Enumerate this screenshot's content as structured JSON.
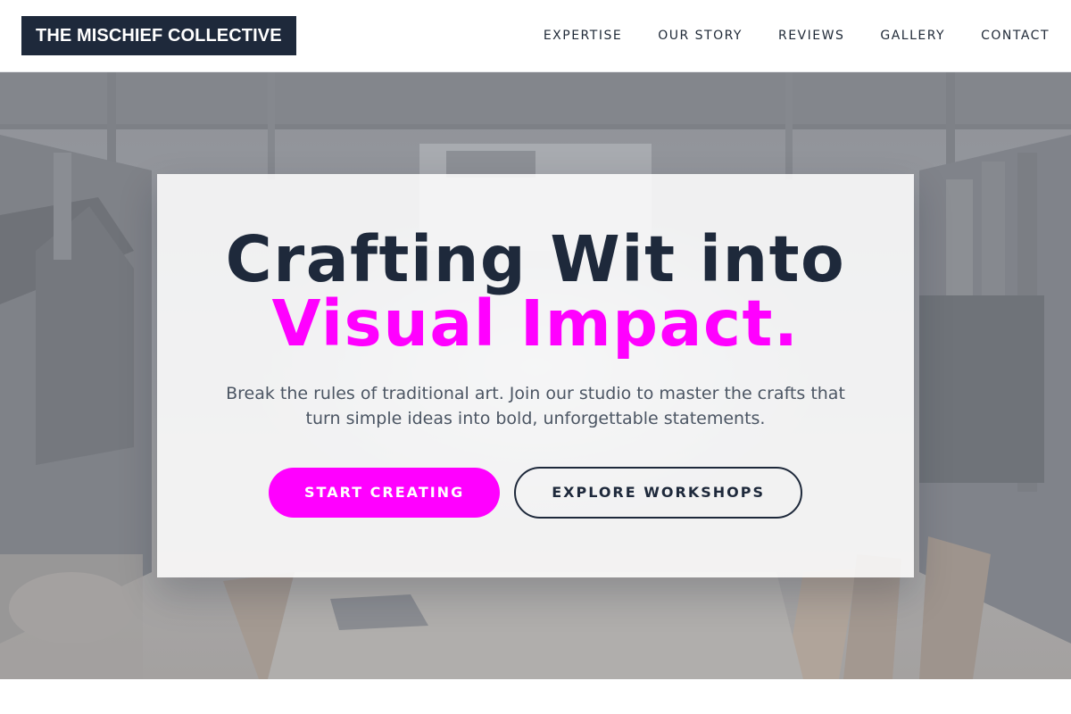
{
  "brand": {
    "name": "THE MISCHIEF COLLECTIVE"
  },
  "nav": {
    "items": [
      {
        "label": "EXPERTISE"
      },
      {
        "label": "OUR STORY"
      },
      {
        "label": "REVIEWS"
      },
      {
        "label": "GALLERY"
      },
      {
        "label": "CONTACT"
      }
    ]
  },
  "hero": {
    "headline_line1": "Crafting Wit into",
    "headline_line2": "Visual Impact.",
    "subtext": "Break the rules of traditional art. Join our studio to master the crafts that turn simple ideas into bold, unforgettable statements.",
    "primary_button": "START CREATING",
    "secondary_button": "EXPLORE WORKSHOPS"
  },
  "colors": {
    "brand_dark": "#1e293b",
    "accent_magenta": "#ff00ff",
    "body_text": "#4b5563"
  }
}
